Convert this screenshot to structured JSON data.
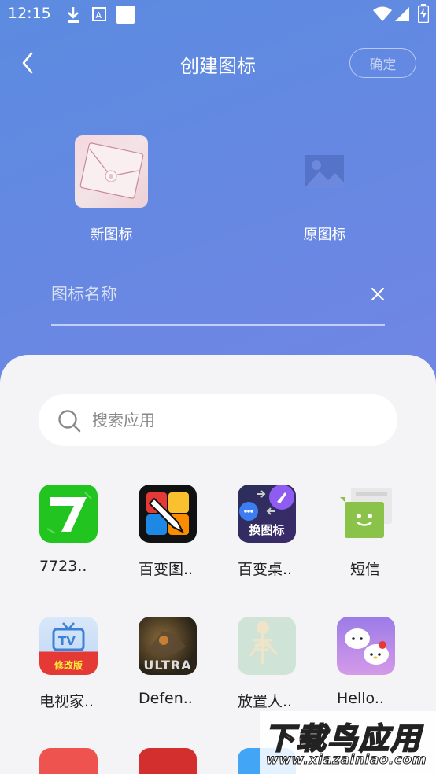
{
  "status_bar": {
    "time": "12:15"
  },
  "header": {
    "title": "创建图标",
    "confirm_label": "确定"
  },
  "preview": {
    "new_icon_label": "新图标",
    "original_icon_label": "原图标"
  },
  "name_field": {
    "placeholder": "图标名称",
    "value": ""
  },
  "search": {
    "placeholder": "搜索应用"
  },
  "apps": [
    {
      "label": "7723..",
      "icon": "7723-app-icon"
    },
    {
      "label": "百变图..",
      "icon": "paintbrush-app-icon"
    },
    {
      "label": "百变桌..",
      "icon": "rocket-app-icon",
      "badge": "换图标"
    },
    {
      "label": "短信",
      "icon": "sms-app-icon"
    },
    {
      "label": "电视家..",
      "icon": "tv-app-icon",
      "badge": "修改版"
    },
    {
      "label": "Defen..",
      "icon": "defense-game-icon",
      "badge": "ULTRA"
    },
    {
      "label": "放置人..",
      "icon": "skeleton-app-icon"
    },
    {
      "label": "Hello..",
      "icon": "hello-kitty-app-icon"
    }
  ],
  "watermark": {
    "title": "下载鸟应用",
    "url": "www.xiazainiao.com"
  },
  "colors": {
    "header_bg": "#6b88e2",
    "sheet_bg": "#f4f4f6",
    "green": "#22c51f",
    "sms_green": "#8bc34a"
  }
}
